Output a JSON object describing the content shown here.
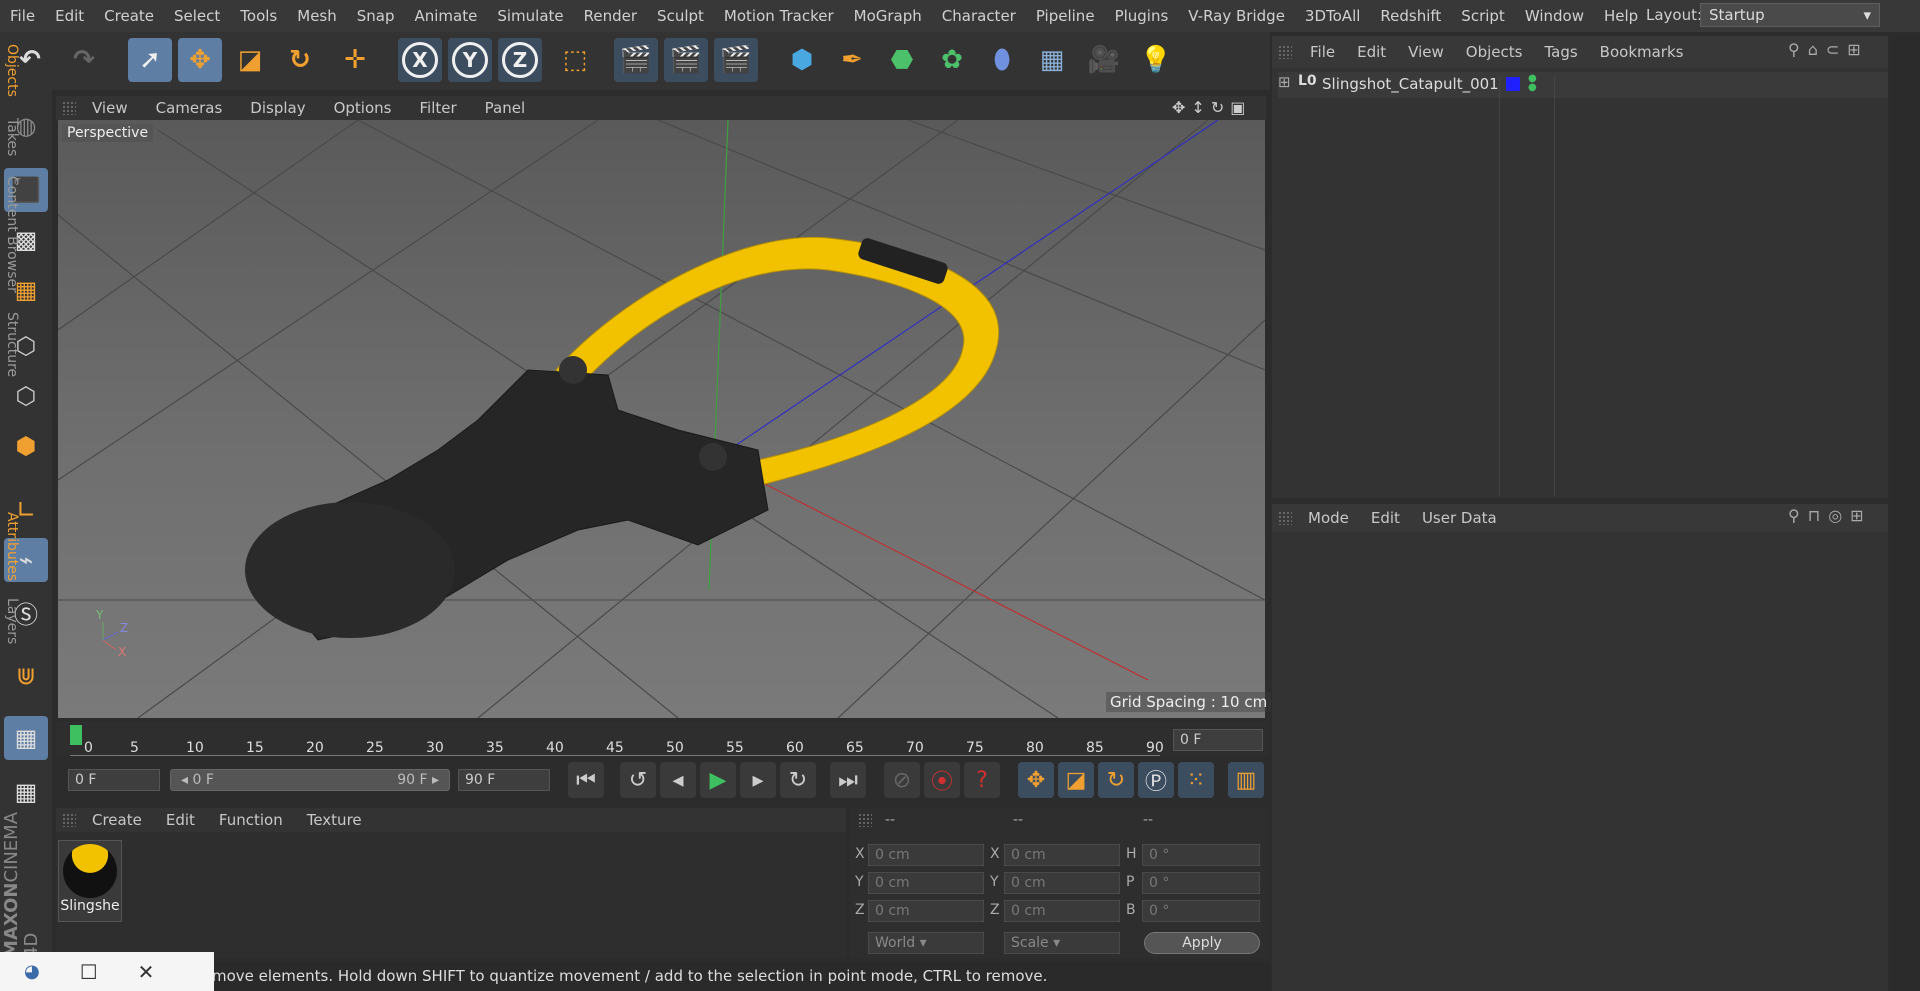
{
  "menubar": {
    "items": [
      "File",
      "Edit",
      "Create",
      "Select",
      "Tools",
      "Mesh",
      "Snap",
      "Animate",
      "Simulate",
      "Render",
      "Sculpt",
      "Motion Tracker",
      "MoGraph",
      "Character",
      "Pipeline",
      "Plugins",
      "V-Ray Bridge",
      "3DToAll",
      "Redshift",
      "Script",
      "Window",
      "Help"
    ],
    "layout_label": "Layout:",
    "layout_value": "Startup"
  },
  "toolbar": {
    "axis_x": "X",
    "axis_y": "Y",
    "axis_z": "Z"
  },
  "viewport": {
    "menu": [
      "View",
      "Cameras",
      "Display",
      "Options",
      "Filter",
      "Panel"
    ],
    "label": "Perspective",
    "grid_spacing": "Grid Spacing : 10 cm"
  },
  "timeline": {
    "ticks": [
      "0",
      "5",
      "10",
      "15",
      "20",
      "25",
      "30",
      "35",
      "40",
      "45",
      "50",
      "55",
      "60",
      "65",
      "70",
      "75",
      "80",
      "85",
      "90"
    ],
    "current_frame": "0 F",
    "start_frame": "0 F",
    "range_start": "0 F",
    "range_end": "90 F",
    "end_frame": "90 F"
  },
  "material": {
    "menu": [
      "Create",
      "Edit",
      "Function",
      "Texture"
    ],
    "item_label": "Slingshe"
  },
  "coords": {
    "headers": [
      "--",
      "--",
      "--"
    ],
    "rows": [
      {
        "l1": "X",
        "v1": "0 cm",
        "l2": "X",
        "v2": "0 cm",
        "l3": "H",
        "v3": "0 °"
      },
      {
        "l1": "Y",
        "v1": "0 cm",
        "l2": "Y",
        "v2": "0 cm",
        "l3": "P",
        "v3": "0 °"
      },
      {
        "l1": "Z",
        "v1": "0 cm",
        "l2": "Z",
        "v2": "0 cm",
        "l3": "B",
        "v3": "0 °"
      }
    ],
    "mode_world": "World",
    "mode_scale": "Scale",
    "apply": "Apply"
  },
  "status": {
    "text": "move elements. Hold down SHIFT to quantize movement / add to the selection in point mode, CTRL to remove."
  },
  "objects": {
    "menu": [
      "File",
      "Edit",
      "View",
      "Objects",
      "Tags",
      "Bookmarks"
    ],
    "item": "Slingshot_Catapult_001"
  },
  "attributes": {
    "menu": [
      "Mode",
      "Edit",
      "User Data"
    ]
  },
  "sidetabs": {
    "top": [
      "Objects",
      "Takes",
      "Content Browser",
      "Structure"
    ],
    "bottom": [
      "Attributes",
      "Layers"
    ]
  },
  "branding": {
    "line1": "MAXON",
    "line2": "CINEMA 4D"
  },
  "colors": {
    "accent": "#5f7ea3",
    "highlight": "#f0a030",
    "rope": "#f2c200"
  }
}
